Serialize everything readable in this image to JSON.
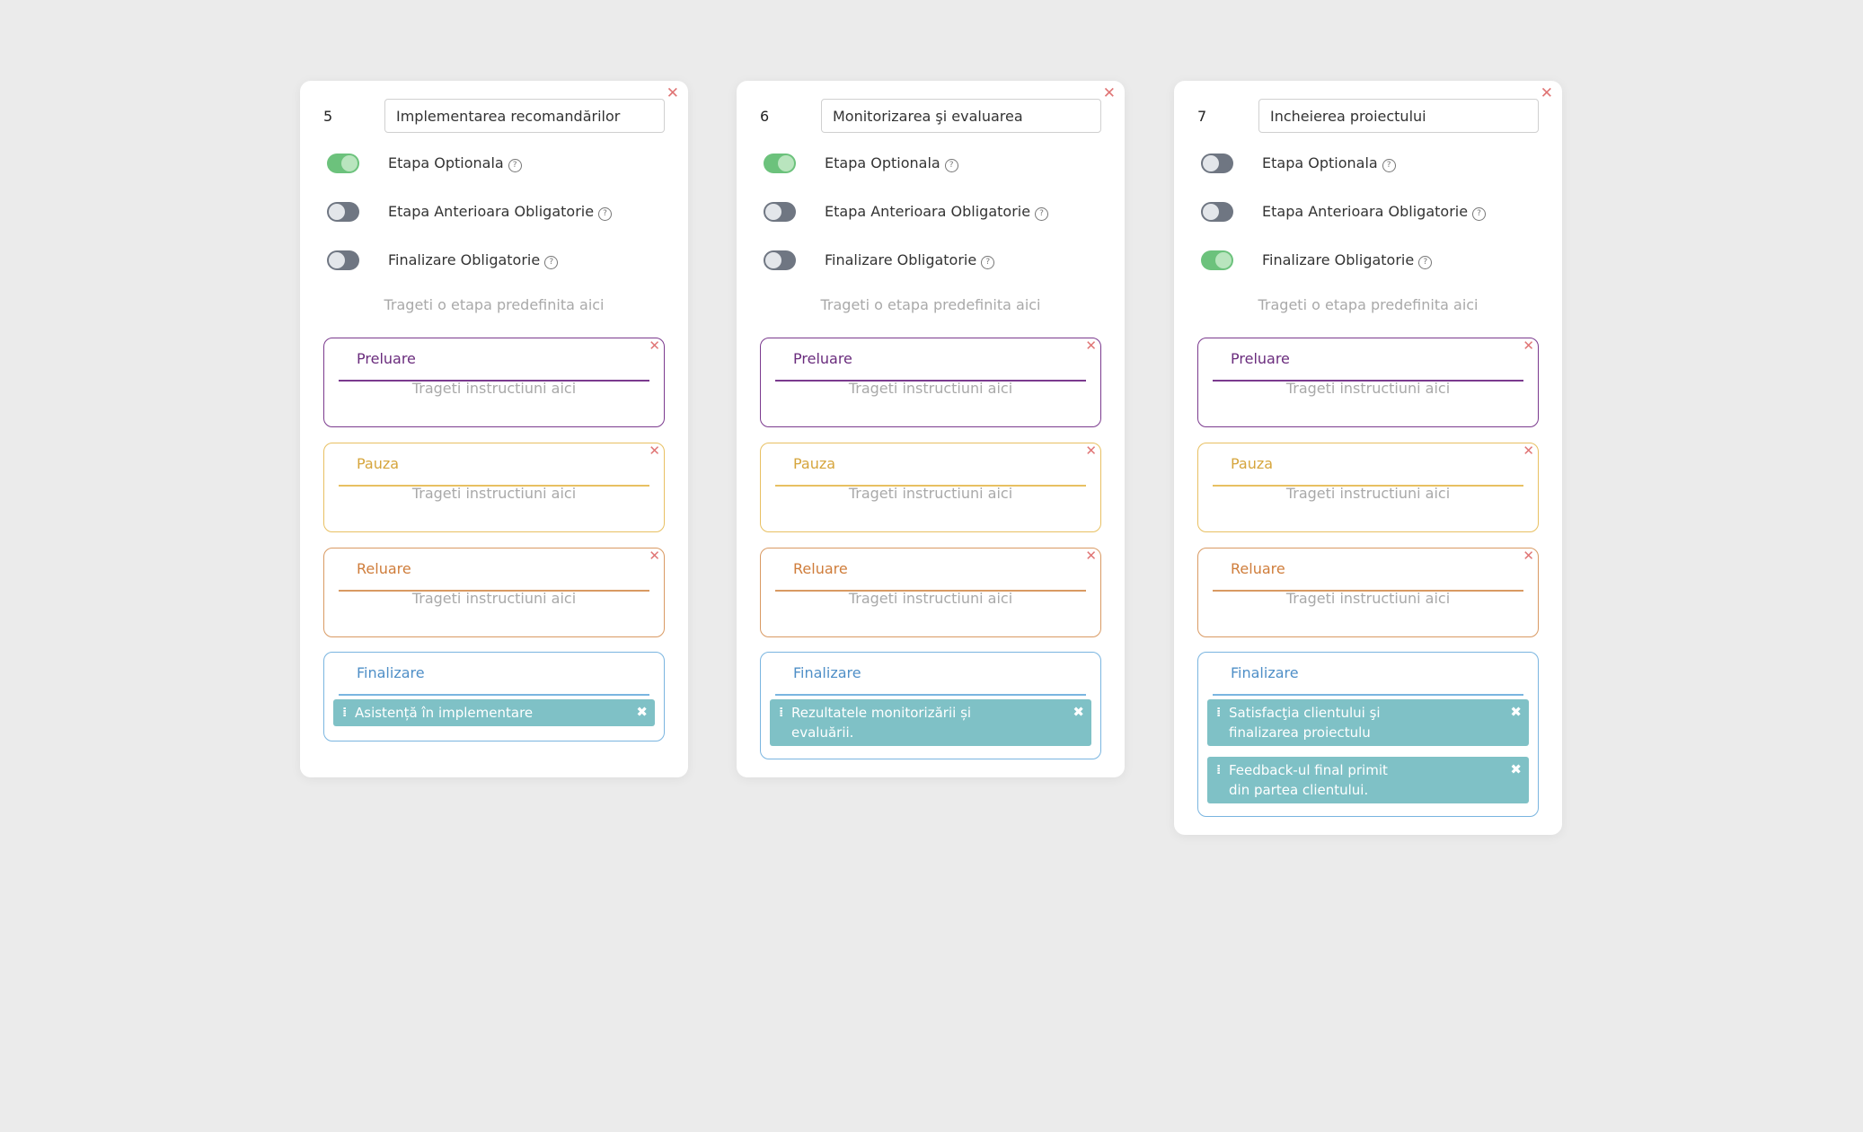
{
  "cards": [
    {
      "number": "5",
      "name": "Implementarea recomandărilor",
      "toggles": [
        {
          "label": "Etapa Optionala",
          "state": "on"
        },
        {
          "label": "Etapa Anterioara Obligatorie",
          "state": "off"
        },
        {
          "label": "Finalizare Obligatorie",
          "state": "off"
        }
      ],
      "drop_hint": "Trageti o etapa predefinita aici",
      "sections": {
        "preluare": {
          "title": "Preluare",
          "hint": "Trageti instructiuni aici"
        },
        "pauza": {
          "title": "Pauza",
          "hint": "Trageti instructiuni aici"
        },
        "reluare": {
          "title": "Reluare",
          "hint": "Trageti instructiuni aici"
        },
        "finalizare": {
          "title": "Finalizare",
          "items": [
            {
              "lines": [
                "Asistență în implementare"
              ]
            }
          ]
        }
      }
    },
    {
      "number": "6",
      "name": "Monitorizarea şi evaluarea",
      "toggles": [
        {
          "label": "Etapa Optionala",
          "state": "on"
        },
        {
          "label": "Etapa Anterioara Obligatorie",
          "state": "off"
        },
        {
          "label": "Finalizare Obligatorie",
          "state": "off"
        }
      ],
      "drop_hint": "Trageti o etapa predefinita aici",
      "sections": {
        "preluare": {
          "title": "Preluare",
          "hint": "Trageti instructiuni aici"
        },
        "pauza": {
          "title": "Pauza",
          "hint": "Trageti instructiuni aici"
        },
        "reluare": {
          "title": "Reluare",
          "hint": "Trageti instructiuni aici"
        },
        "finalizare": {
          "title": "Finalizare",
          "items": [
            {
              "lines": [
                "Rezultatele monitorizării și",
                "evaluării."
              ]
            }
          ]
        }
      }
    },
    {
      "number": "7",
      "name": "Incheierea proiectului",
      "toggles": [
        {
          "label": "Etapa Optionala",
          "state": "off"
        },
        {
          "label": "Etapa Anterioara Obligatorie",
          "state": "off"
        },
        {
          "label": "Finalizare Obligatorie",
          "state": "on"
        }
      ],
      "drop_hint": "Trageti o etapa predefinita aici",
      "sections": {
        "preluare": {
          "title": "Preluare",
          "hint": "Trageti instructiuni aici"
        },
        "pauza": {
          "title": "Pauza",
          "hint": "Trageti instructiuni aici"
        },
        "reluare": {
          "title": "Reluare",
          "hint": "Trageti instructiuni aici"
        },
        "finalizare": {
          "title": "Finalizare",
          "items": [
            {
              "lines": [
                "Satisfacţia clientului şi",
                "finalizarea proiectulu"
              ]
            },
            {
              "lines": [
                "Feedback-ul final primit",
                "din partea clientului."
              ]
            }
          ]
        }
      }
    }
  ],
  "icons": {
    "close": "close-icon",
    "help": "help-icon",
    "grip": "drag-handle-icon"
  },
  "colors": {
    "background": "#ebebeb",
    "toggle_on": "#6cc27c",
    "toggle_off": "#6f7682",
    "preluare": "#7b3a8e",
    "pauza": "#e8c062",
    "reluare": "#d99a63",
    "finalizare": "#7ab5e0",
    "instruction": "#7fc1c6",
    "close": "#e07575"
  }
}
